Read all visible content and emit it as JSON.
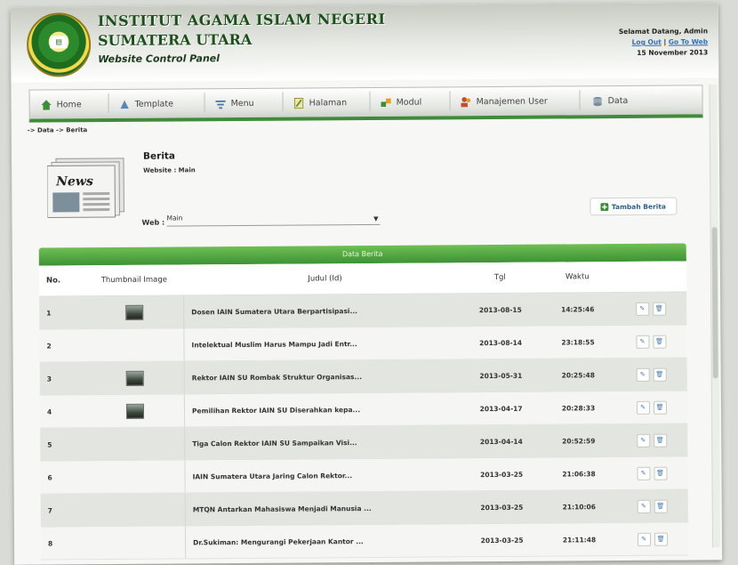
{
  "header": {
    "title_line1": "INSTITUT AGAMA ISLAM NEGERI",
    "title_line2": "SUMATERA UTARA",
    "subtitle": "Website Control Panel",
    "welcome": "Selamat Datang, Admin",
    "logout": "Log Out",
    "separator": "|",
    "goto_web": "Go To Web",
    "date": "15 November 2013"
  },
  "nav": {
    "items": [
      {
        "label": "Home",
        "icon": "home-icon"
      },
      {
        "label": "Template",
        "icon": "template-icon"
      },
      {
        "label": "Menu",
        "icon": "menu-icon"
      },
      {
        "label": "Halaman",
        "icon": "page-icon"
      },
      {
        "label": "Modul",
        "icon": "module-icon"
      },
      {
        "label": "Manajemen User",
        "icon": "users-icon"
      },
      {
        "label": "Data",
        "icon": "data-icon"
      }
    ]
  },
  "breadcrumb": "-> Data -> Berita",
  "section": {
    "title": "Berita",
    "website_label": "Website : Main",
    "web_label": "Web :",
    "web_value": "Main",
    "add_button": "Tambah Berita",
    "news_image_text": "News"
  },
  "table": {
    "caption": "Data Berita",
    "headers": {
      "no": "No.",
      "thumb": "Thumbnail Image",
      "judul": "Judul (Id)",
      "tgl": "Tgl",
      "waktu": "Waktu"
    },
    "rows": [
      {
        "no": "1",
        "thumb": true,
        "judul": "Dosen IAIN Sumatera Utara Berpartisipasi...",
        "tgl": "2013-08-15",
        "waktu": "14:25:46"
      },
      {
        "no": "2",
        "thumb": false,
        "judul": "Intelektual Muslim Harus Mampu Jadi Entr...",
        "tgl": "2013-08-14",
        "waktu": "23:18:55"
      },
      {
        "no": "3",
        "thumb": true,
        "judul": "Rektor IAIN SU Rombak Struktur Organisas...",
        "tgl": "2013-05-31",
        "waktu": "20:25:48"
      },
      {
        "no": "4",
        "thumb": true,
        "judul": "Pemilihan Rektor IAIN SU Diserahkan kepa...",
        "tgl": "2013-04-17",
        "waktu": "20:28:33"
      },
      {
        "no": "5",
        "thumb": false,
        "judul": "Tiga Calon Rektor IAIN SU Sampaikan Visi...",
        "tgl": "2013-04-14",
        "waktu": "20:52:59"
      },
      {
        "no": "6",
        "thumb": false,
        "judul": "IAIN Sumatera Utara Jaring Calon Rektor...",
        "tgl": "2013-03-25",
        "waktu": "21:06:38"
      },
      {
        "no": "7",
        "thumb": false,
        "judul": "MTQN Antarkan Mahasiswa Menjadi Manusia ...",
        "tgl": "2013-03-25",
        "waktu": "21:10:06"
      },
      {
        "no": "8",
        "thumb": false,
        "judul": "Dr.Sukiman: Mengurangi Pekerjaan Kantor ...",
        "tgl": "2013-03-25",
        "waktu": "21:11:48"
      }
    ]
  },
  "colors": {
    "accent": "#3d9235",
    "title": "#1d4f1d",
    "link": "#2f6fb5"
  }
}
